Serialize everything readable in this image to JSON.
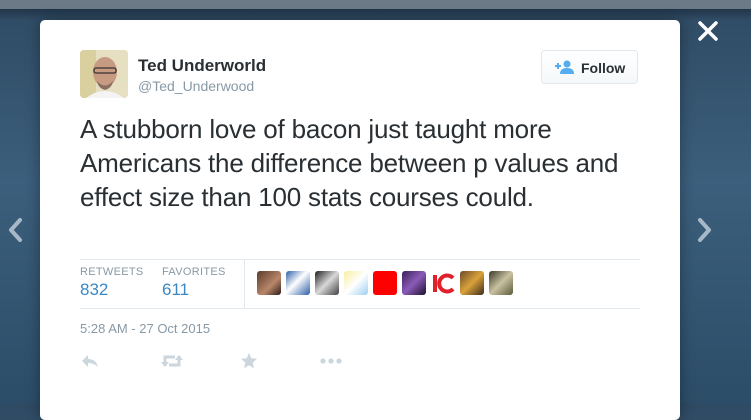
{
  "tweet": {
    "display_name": "Ted Underworld",
    "handle": "@Ted_Underwood",
    "text": "A stubborn love of bacon just taught more Americans the difference between p values and effect size than 100 stats courses could.",
    "timestamp": "5:28 AM - 27 Oct 2015",
    "follow_label": "Follow",
    "stats": {
      "retweets_label": "RETWEETS",
      "retweets_value": "832",
      "favorites_label": "FAVORITES",
      "favorites_value": "611"
    },
    "favoriters_icons": [
      "avatar",
      "avatar",
      "avatar",
      "avatar",
      "avatar",
      "avatar",
      "avatar",
      "avatar",
      "avatar"
    ],
    "actions": [
      "reply-icon",
      "retweet-icon",
      "favorite-icon",
      "more-icon"
    ]
  },
  "overlay": {
    "close_icon": "close-icon",
    "prev_icon": "chevron-left-icon",
    "next_icon": "chevron-right-icon"
  },
  "colors": {
    "link": "#3b88c3",
    "muted": "#8899a6",
    "text": "#292f33",
    "backdrop": "#34546f"
  }
}
